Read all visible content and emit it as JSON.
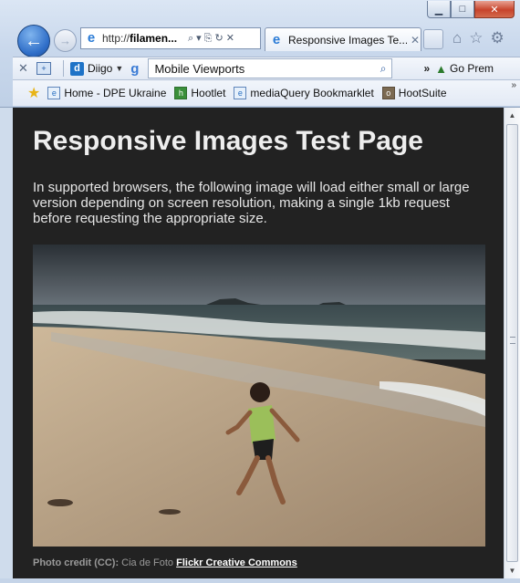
{
  "window": {
    "controls": {
      "minimize": "▁",
      "maximize": "□",
      "close": "✕"
    }
  },
  "nav": {
    "back_icon": "back-arrow-icon",
    "forward_icon": "forward-arrow-icon",
    "address": {
      "prefix": "http://",
      "host": "filamen...",
      "controls": "⌕▾⎘↻✕"
    },
    "tab": {
      "title": "Responsive Images Te...",
      "close": "✕"
    },
    "right_icons": [
      "home-icon",
      "favorites-star-icon",
      "gear-icon"
    ]
  },
  "command_bar": {
    "close": "✕",
    "diigo_label": "Diigo",
    "search_value": "Mobile Viewports",
    "more": "»",
    "gopre_label": "Go Prem"
  },
  "favorites": {
    "items": [
      {
        "label": "Home - DPE Ukraine",
        "icon": "ie-page-icon"
      },
      {
        "label": "Hootlet",
        "icon": "hootlet-icon"
      },
      {
        "label": "mediaQuery Bookmarklet",
        "icon": "ie-page-icon"
      },
      {
        "label": "HootSuite",
        "icon": "hootsuite-icon"
      }
    ],
    "overflow": "»"
  },
  "page": {
    "title": "Responsive Images Test Page",
    "description": "In supported browsers, the following image will load either small or large version depending on screen resolution, making a single 1kb request before requesting the appropriate size.",
    "credit_label": "Photo credit (CC):",
    "credit_text": "Cia de Foto",
    "credit_link": "Flickr Creative Commons",
    "background_color": "#222222"
  }
}
